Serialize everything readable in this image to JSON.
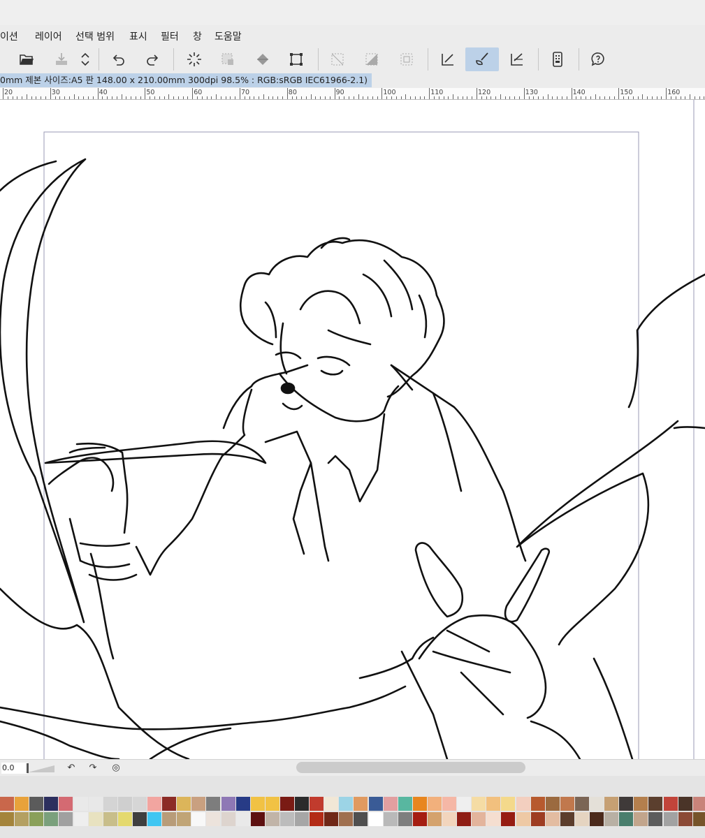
{
  "menu": {
    "items": [
      "이션",
      "레이어",
      "선택 범위",
      "표시",
      "필터",
      "창",
      "도움말"
    ]
  },
  "toolbar": {
    "tools": [
      {
        "icon": "new-file-icon"
      },
      {
        "icon": "open-folder-icon"
      },
      {
        "icon": "save-icon"
      },
      {
        "icon": "scroll-updown-icon"
      },
      {
        "icon": "undo-icon"
      },
      {
        "icon": "redo-icon"
      },
      {
        "icon": "loading-spinner-icon"
      },
      {
        "icon": "selection-transform-icon"
      },
      {
        "icon": "fill-bucket-icon"
      },
      {
        "icon": "transform-box-icon"
      },
      {
        "icon": "clear-selection-icon"
      },
      {
        "icon": "invert-selection-icon"
      },
      {
        "icon": "selection-border-icon"
      },
      {
        "icon": "ruler-line-icon"
      },
      {
        "icon": "pen-brush-icon",
        "active": true
      },
      {
        "icon": "correct-line-icon"
      },
      {
        "icon": "device-settings-icon"
      },
      {
        "icon": "help-bubble-icon"
      }
    ]
  },
  "infobar": {
    "text": "0mm 제본 사이즈:A5 판 148.00 x 210.00mm 300dpi 98.5% : RGB:sRGB IEC61966-2.1)"
  },
  "ruler": {
    "labels": [
      "20",
      "30",
      "40",
      "50",
      "60",
      "70",
      "80",
      "90",
      "100",
      "110",
      "120",
      "130",
      "140",
      "150",
      "160"
    ]
  },
  "statusbar": {
    "zoom_value": "0.0",
    "icons": [
      "rotate-left-icon",
      "rotate-right-icon",
      "reset-rotation-icon"
    ]
  },
  "palette": {
    "row1": [
      "#c9674b",
      "#e8a23b",
      "#5b5b5b",
      "#2c2f5e",
      "#d46a72",
      "#e9e9e9",
      "#e8e8e8",
      "#d4d4d4",
      "#cfcfcf",
      "#d6d6d6",
      "#f2a5a0",
      "#8c2b26",
      "#dcb55a",
      "#c9a080",
      "#7d7d7d",
      "#8e78b5",
      "#273b86",
      "#f1c244",
      "#f1c244",
      "#7a1b14",
      "#2b2b2b",
      "#c13b2d",
      "#f1e7d6",
      "#9cd4e6",
      "#e09a60",
      "#3a5b96",
      "#e29fa0",
      "#58b7a0",
      "#e8861f",
      "#f2b07c",
      "#f5b7a6",
      "#efefef",
      "#f5dca4",
      "#f2c07e",
      "#f4d98b",
      "#f3cfbf",
      "#b75a2e",
      "#9b6a3f",
      "#c1784d",
      "#7b6555",
      "#e4e0d8",
      "#c6a073",
      "#3f3a39",
      "#b47f4d",
      "#5b3f2e",
      "#c1443a",
      "#4a3428",
      "#c9837a"
    ],
    "row2": [
      "#a4843c",
      "#b4a062",
      "#8aa05a",
      "#7aa07c",
      "#a0a0a0",
      "#eeeeee",
      "#e8e2c0",
      "#c8be8a",
      "#e4d96e",
      "#3f3f3f",
      "#40c6f2",
      "#b89c79",
      "#c0a476",
      "#f8f8f8",
      "#ece3dc",
      "#ddd4ce",
      "#e9e9e9",
      "#5d1010",
      "#c1b4a8",
      "#bcbcbc",
      "#a6a6a6",
      "#b32b16",
      "#6f2717",
      "#9f6f4f",
      "#4f4f4f",
      "#ffffff",
      "#b9b9b9",
      "#7e7e7e",
      "#a51e12",
      "#d4a26d",
      "#f2d5bd",
      "#8f1d14",
      "#e3b49c",
      "#f5ded0",
      "#961c12",
      "#eec9a5",
      "#9e3c22",
      "#e3bca1",
      "#5c3d2c",
      "#e5d4c1",
      "#4b2a1c",
      "#b8b0a4",
      "#4a7e6d",
      "#c2a58c",
      "#5c5c5c",
      "#a2a2a2",
      "#8b4a36",
      "#76542a"
    ]
  }
}
